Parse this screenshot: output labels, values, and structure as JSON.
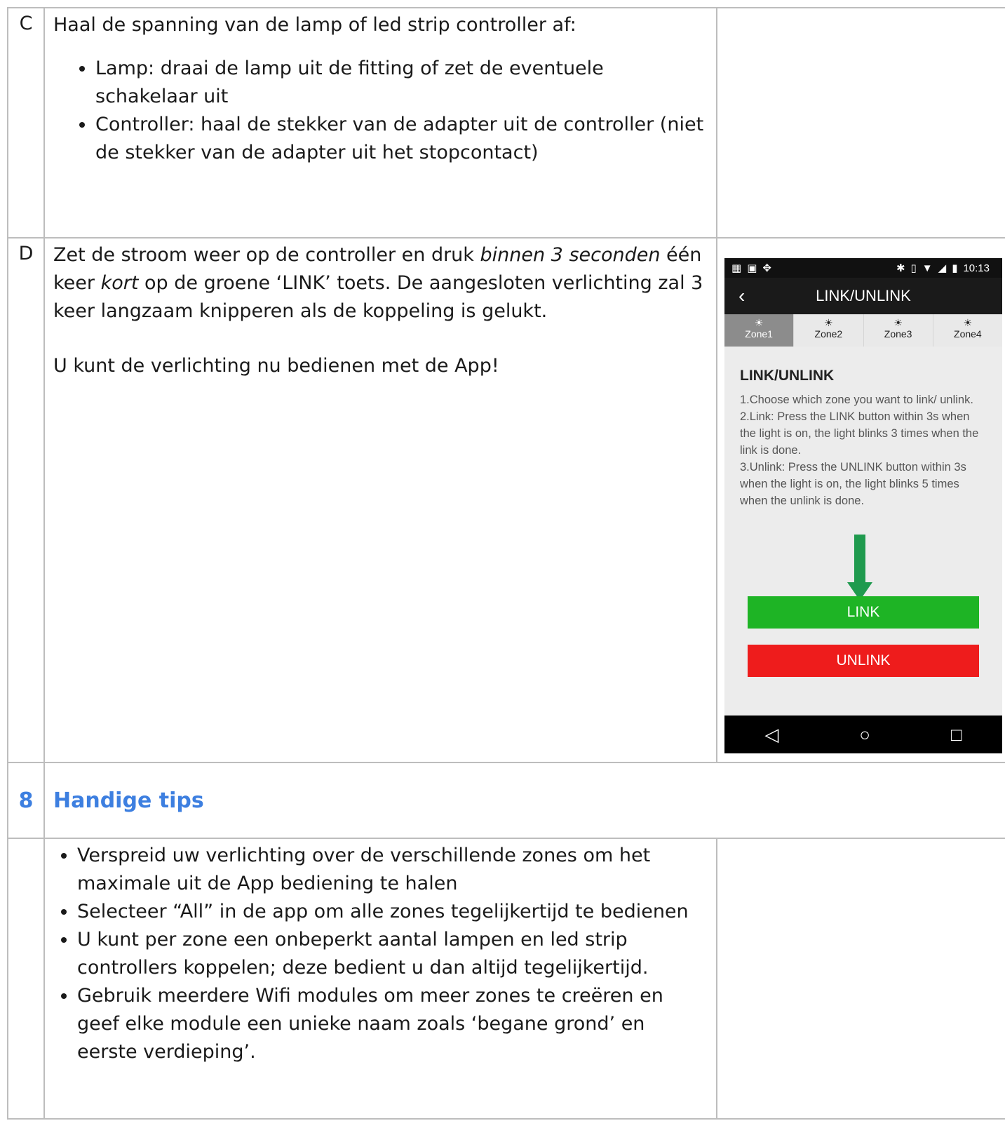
{
  "rows": {
    "c": {
      "letter": "C",
      "intro": "Haal de spanning van de lamp of led strip controller af:",
      "bullets": [
        "Lamp: draai de lamp uit de fitting of zet de eventuele schakelaar uit",
        "Controller: haal de stekker van de adapter uit de controller (niet de stekker van de adapter uit het stopcontact)"
      ]
    },
    "d": {
      "letter": "D",
      "p1_a": "Zet de stroom weer op de controller en druk ",
      "p1_em1": "binnen 3 seconden",
      "p1_b": " één keer ",
      "p1_em2": "kort",
      "p1_c": " op de groene ‘LINK’ toets. De aangesloten verlichting zal 3 keer langzaam knipperen als de koppeling is gelukt.",
      "p2": "U kunt de verlichting nu bedienen met de App!"
    }
  },
  "phone": {
    "status": {
      "time": "10:13",
      "left_icons": [
        "calendar-icon",
        "image-icon",
        "dropbox-icon"
      ],
      "right_icons": [
        "bluetooth-icon",
        "vibrate-icon",
        "wifi-icon",
        "signal-icon",
        "battery-icon"
      ]
    },
    "title": "LINK/UNLINK",
    "tabs": [
      "Zone1",
      "Zone2",
      "Zone3",
      "Zone4"
    ],
    "active_tab": "Zone1",
    "content_title": "LINK/UNLINK",
    "instructions": [
      "1.Choose which zone you want to link/ unlink.",
      "2.Link: Press the LINK button within 3s when the light is on, the light blinks 3 times when the link is done.",
      "3.Unlink: Press the UNLINK button within 3s when the light is on, the light blinks 5 times when the unlink is done."
    ],
    "link_label": "LINK",
    "unlink_label": "UNLINK",
    "link_color": "#1eb425",
    "unlink_color": "#ee1c1c",
    "nav": [
      "◁",
      "○",
      "□"
    ]
  },
  "section": {
    "number": "8",
    "title": "Handige tips",
    "color": "#3d7fe0"
  },
  "tips": [
    "Verspreid uw verlichting over de verschillende zones om het maximale uit de App bediening te halen",
    "Selecteer “All” in de app om alle zones tegelijkertijd te bedienen",
    "U kunt per zone een onbeperkt aantal lampen en led strip controllers koppelen; deze bedient u dan altijd tegelijkertijd.",
    "Gebruik meerdere Wifi modules om meer zones te creëren en geef elke module een unieke naam zoals ‘begane grond’ en eerste verdieping’."
  ]
}
